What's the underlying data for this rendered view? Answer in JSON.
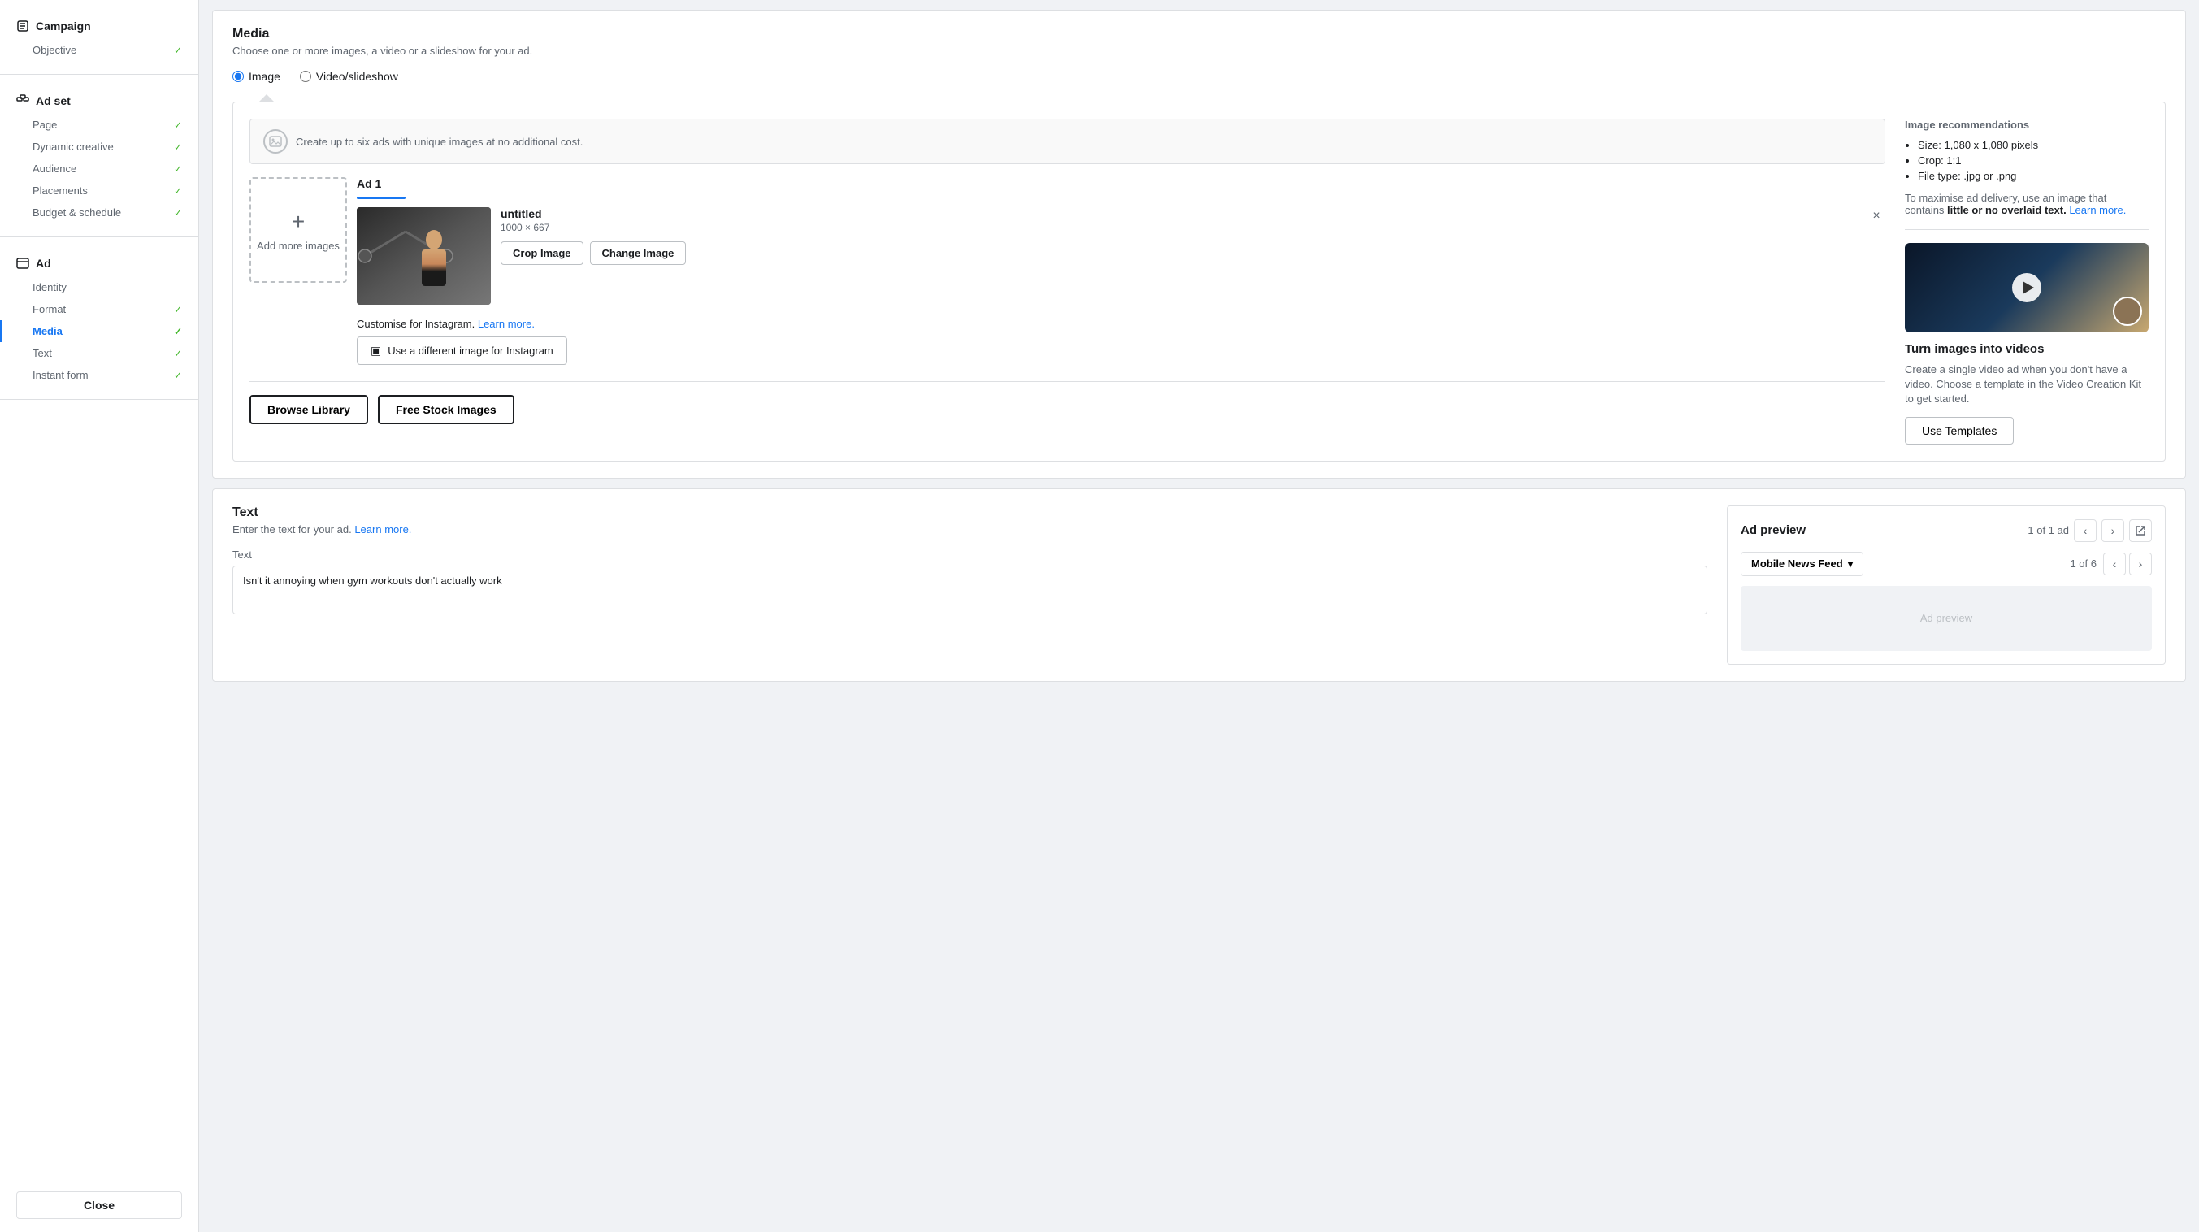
{
  "sidebar": {
    "campaign": {
      "label": "Campaign",
      "items": [
        {
          "label": "Objective",
          "checked": true
        }
      ]
    },
    "adset": {
      "label": "Ad set",
      "items": [
        {
          "label": "Page",
          "checked": true
        },
        {
          "label": "Dynamic creative",
          "checked": true
        },
        {
          "label": "Audience",
          "checked": true
        },
        {
          "label": "Placements",
          "checked": true
        },
        {
          "label": "Budget & schedule",
          "checked": true
        }
      ]
    },
    "ad": {
      "label": "Ad",
      "items": [
        {
          "label": "Identity",
          "checked": false,
          "active": false
        },
        {
          "label": "Format",
          "checked": true,
          "active": false
        },
        {
          "label": "Media",
          "checked": true,
          "active": true
        },
        {
          "label": "Text",
          "checked": true,
          "active": false
        },
        {
          "label": "Instant form",
          "checked": true,
          "active": false
        }
      ]
    },
    "close_label": "Close"
  },
  "media": {
    "title": "Media",
    "subtitle": "Choose one or more images, a video or a slideshow for your ad.",
    "image_radio_label": "Image",
    "video_radio_label": "Video/slideshow",
    "info_text": "Create up to six ads with unique images at no additional cost.",
    "add_images_label": "Add more images",
    "ad1": {
      "label": "Ad 1",
      "filename": "untitled",
      "dimensions": "1000 × 667",
      "crop_btn": "Crop Image",
      "change_btn": "Change Image"
    },
    "customise_text": "Customise for Instagram.",
    "learn_more_label": "Learn more.",
    "instagram_btn_label": "Use a different image for Instagram",
    "browse_library_label": "Browse Library",
    "free_stock_label": "Free Stock Images"
  },
  "recommendations": {
    "title": "Image recommendations",
    "bullet1": "Size: 1,080 x 1,080 pixels",
    "bullet2": "Crop: 1:1",
    "bullet3": "File type: .jpg or .png",
    "note_text": "To maximise ad delivery, use an image that contains",
    "note_bold": "little or no overlaid text.",
    "note_link": "Learn more.",
    "video_title": "Turn images into videos",
    "video_desc": "Create a single video ad when you don't have a video. Choose a template in the Video Creation Kit to get started.",
    "use_templates_label": "Use Templates"
  },
  "text_section": {
    "title": "Text",
    "subtitle": "Enter the text for your ad.",
    "learn_more": "Learn more.",
    "field_label": "Text",
    "field_value": "Isn't it annoying when gym workouts don't actually work"
  },
  "ad_preview": {
    "title": "Ad preview",
    "counter": "1 of 1 ad",
    "placement_label": "Mobile News Feed",
    "placement_counter": "1 of 6"
  }
}
